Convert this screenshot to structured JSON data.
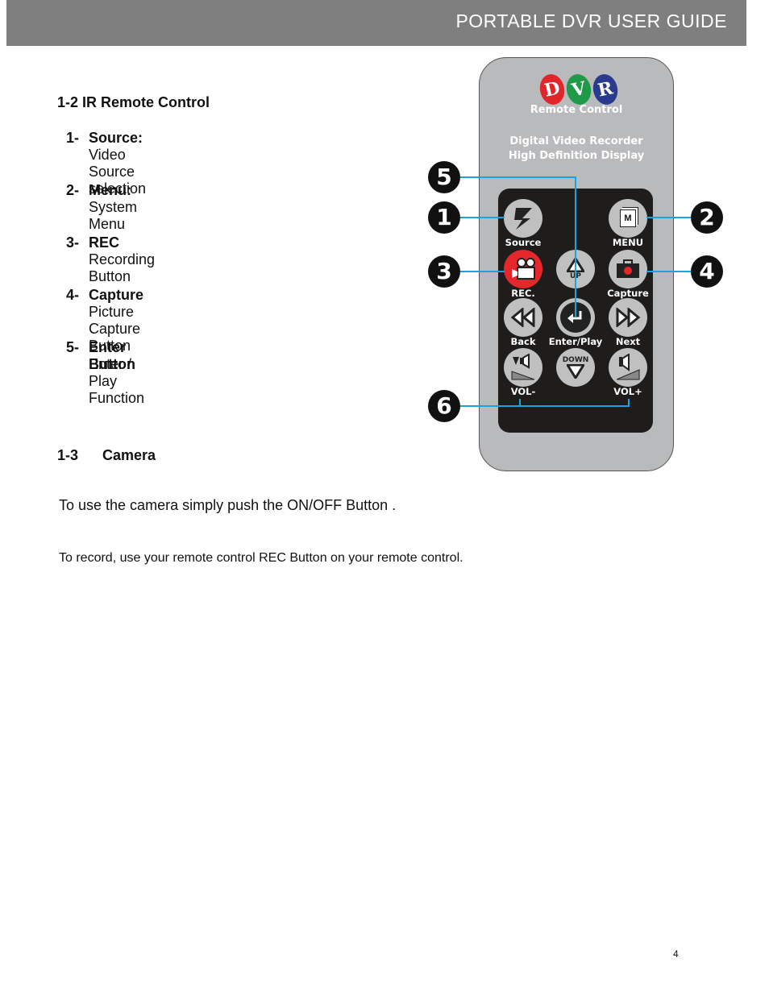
{
  "header": {
    "title": "PORTABLE DVR USER GUIDE"
  },
  "section_remote": {
    "title": "1-2 IR Remote Control",
    "items": [
      {
        "num": "1-",
        "name": "Source:",
        "desc": "Video Source selection"
      },
      {
        "num": "2-",
        "name": "Menu:",
        "desc": "System Menu"
      },
      {
        "num": "3-",
        "name": "REC",
        "desc": "Recording Button"
      },
      {
        "num": "4-",
        "name": "Capture",
        "desc": "Picture Capture Button"
      },
      {
        "num": "5-",
        "name": "Enter Button",
        "desc": "Enter / Play Function"
      }
    ]
  },
  "section_camera": {
    "num": "1-3",
    "title": "Camera",
    "para1": "To use the camera simply push the ON/OFF Button  .",
    "para2": "To record, use your remote control REC Button on your remote control."
  },
  "remote_image": {
    "logo": [
      {
        "letter": "D",
        "color": "#e0262b"
      },
      {
        "letter": "V",
        "color": "#1f9a48"
      },
      {
        "letter": "R",
        "color": "#2a3b8f"
      }
    ],
    "subtitle": "Remote Control",
    "line1": "Digital Video Recorder",
    "line2": "High Definition Display",
    "buttons": {
      "source": "Source",
      "menu": "MENU",
      "rec": "REC.",
      "up": "UP",
      "capture": "Capture",
      "back": "Back",
      "enter": "Enter/Play",
      "next": "Next",
      "vol_down": "VOL-",
      "down": "DOWN",
      "vol_up": "VOL+",
      "menu_glyph": "M"
    },
    "callouts": [
      "1",
      "2",
      "3",
      "4",
      "5",
      "6"
    ],
    "leader_color": "#1aa3dd"
  },
  "footer": {
    "page_number": "4"
  }
}
